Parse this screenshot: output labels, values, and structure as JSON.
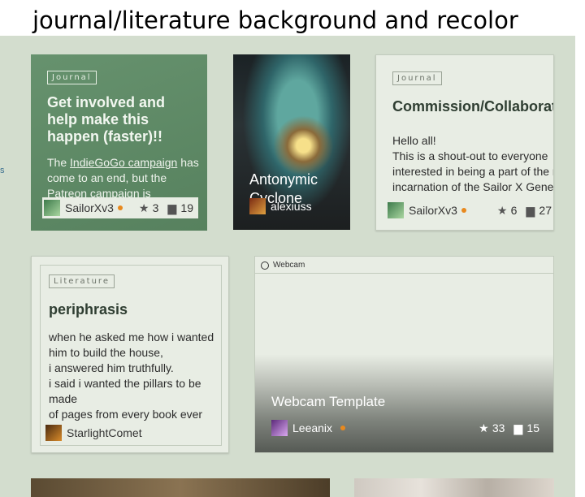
{
  "caption": "journal/literature background and recolor",
  "left_edge_text": "s",
  "cards": [
    {
      "tag": "Journal",
      "title": "Get involved and help make this happen (faster)!!",
      "body_pre": "The ",
      "body_link": "IndieGoGo campaign",
      "body_post": " has come to an end, but the Patreon campaign is",
      "author": "SailorXv3",
      "favs": "3",
      "comments": "19"
    },
    {
      "title": "Antonymic Cyclone",
      "author": "alexiuss"
    },
    {
      "tag": "Journal",
      "title": "Commission/Collaborat call!!",
      "body_lines": [
        "Hello all!",
        "This is a shout-out to everyone",
        "interested in being a part of the n",
        "incarnation of the Sailor X Genera"
      ],
      "author": "SailorXv3",
      "favs": "6",
      "comments": "27"
    },
    {
      "tag": "Literature",
      "title": "periphrasis",
      "body_lines": [
        "when he asked me how i wanted",
        "him to build the house,",
        "i answered him truthfully.",
        "i said i wanted the pillars to be",
        "made",
        "of pages from every book ever"
      ],
      "author": "StarlightComet"
    },
    {
      "label": "Webcam",
      "title": "Webcam Template",
      "author": "Leeanix",
      "favs": "33",
      "comments": "15"
    }
  ],
  "icons": {
    "star": "star-icon",
    "comment": "comment-icon",
    "webcam": "webcam-icon"
  },
  "colors": {
    "background": "#d3ddce",
    "card": "#e8ede4",
    "journal_highlight": "#5e8c66",
    "status_dot": "#e8891e"
  }
}
